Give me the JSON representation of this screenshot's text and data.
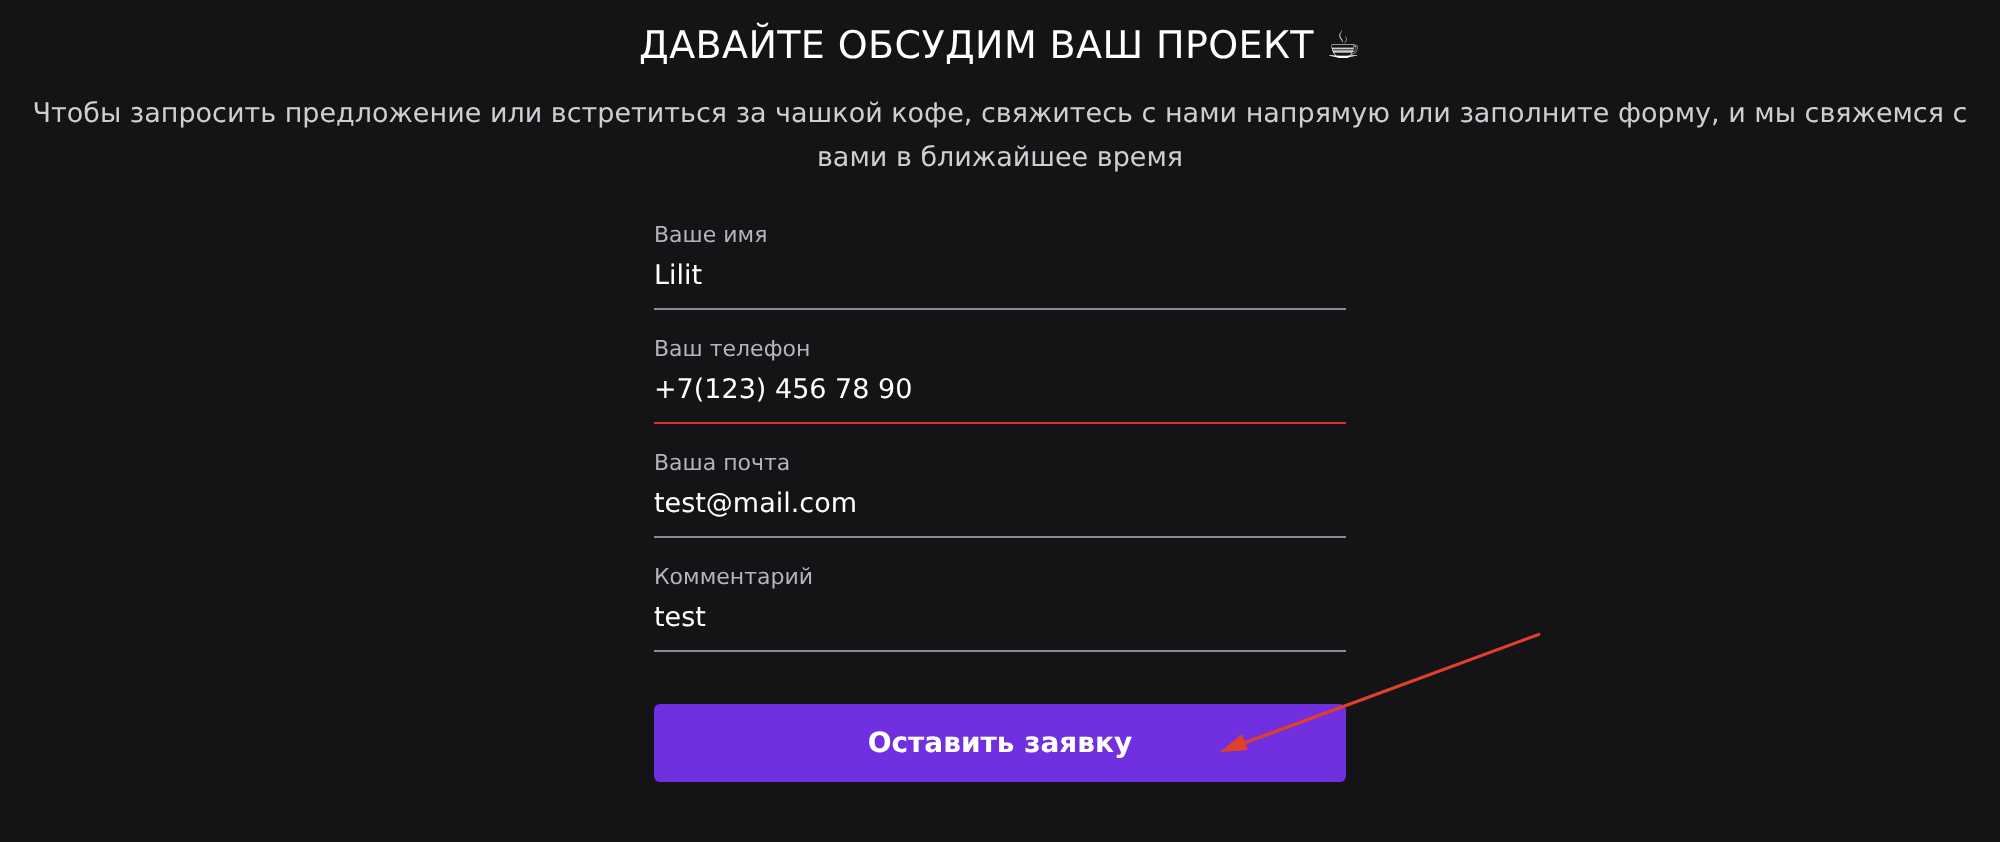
{
  "title": "ДАВАЙТЕ ОБСУДИМ ВАШ ПРОЕКТ ☕",
  "subtitle": "Чтобы запросить предложение или встретиться за чашкой кофе, свяжитесь с нами напрямую или заполните форму, и мы свяжемся с вами в ближайшее время",
  "fields": [
    {
      "label": "Ваше имя",
      "value": "Lilit",
      "error": false
    },
    {
      "label": "Ваш телефон",
      "value": "+7(123) 456 78 90",
      "error": true
    },
    {
      "label": "Ваша почта",
      "value": "test@mail.com",
      "error": false
    },
    {
      "label": "Комментарий",
      "value": "test",
      "error": false
    }
  ],
  "submit_button": "Оставить заявку"
}
